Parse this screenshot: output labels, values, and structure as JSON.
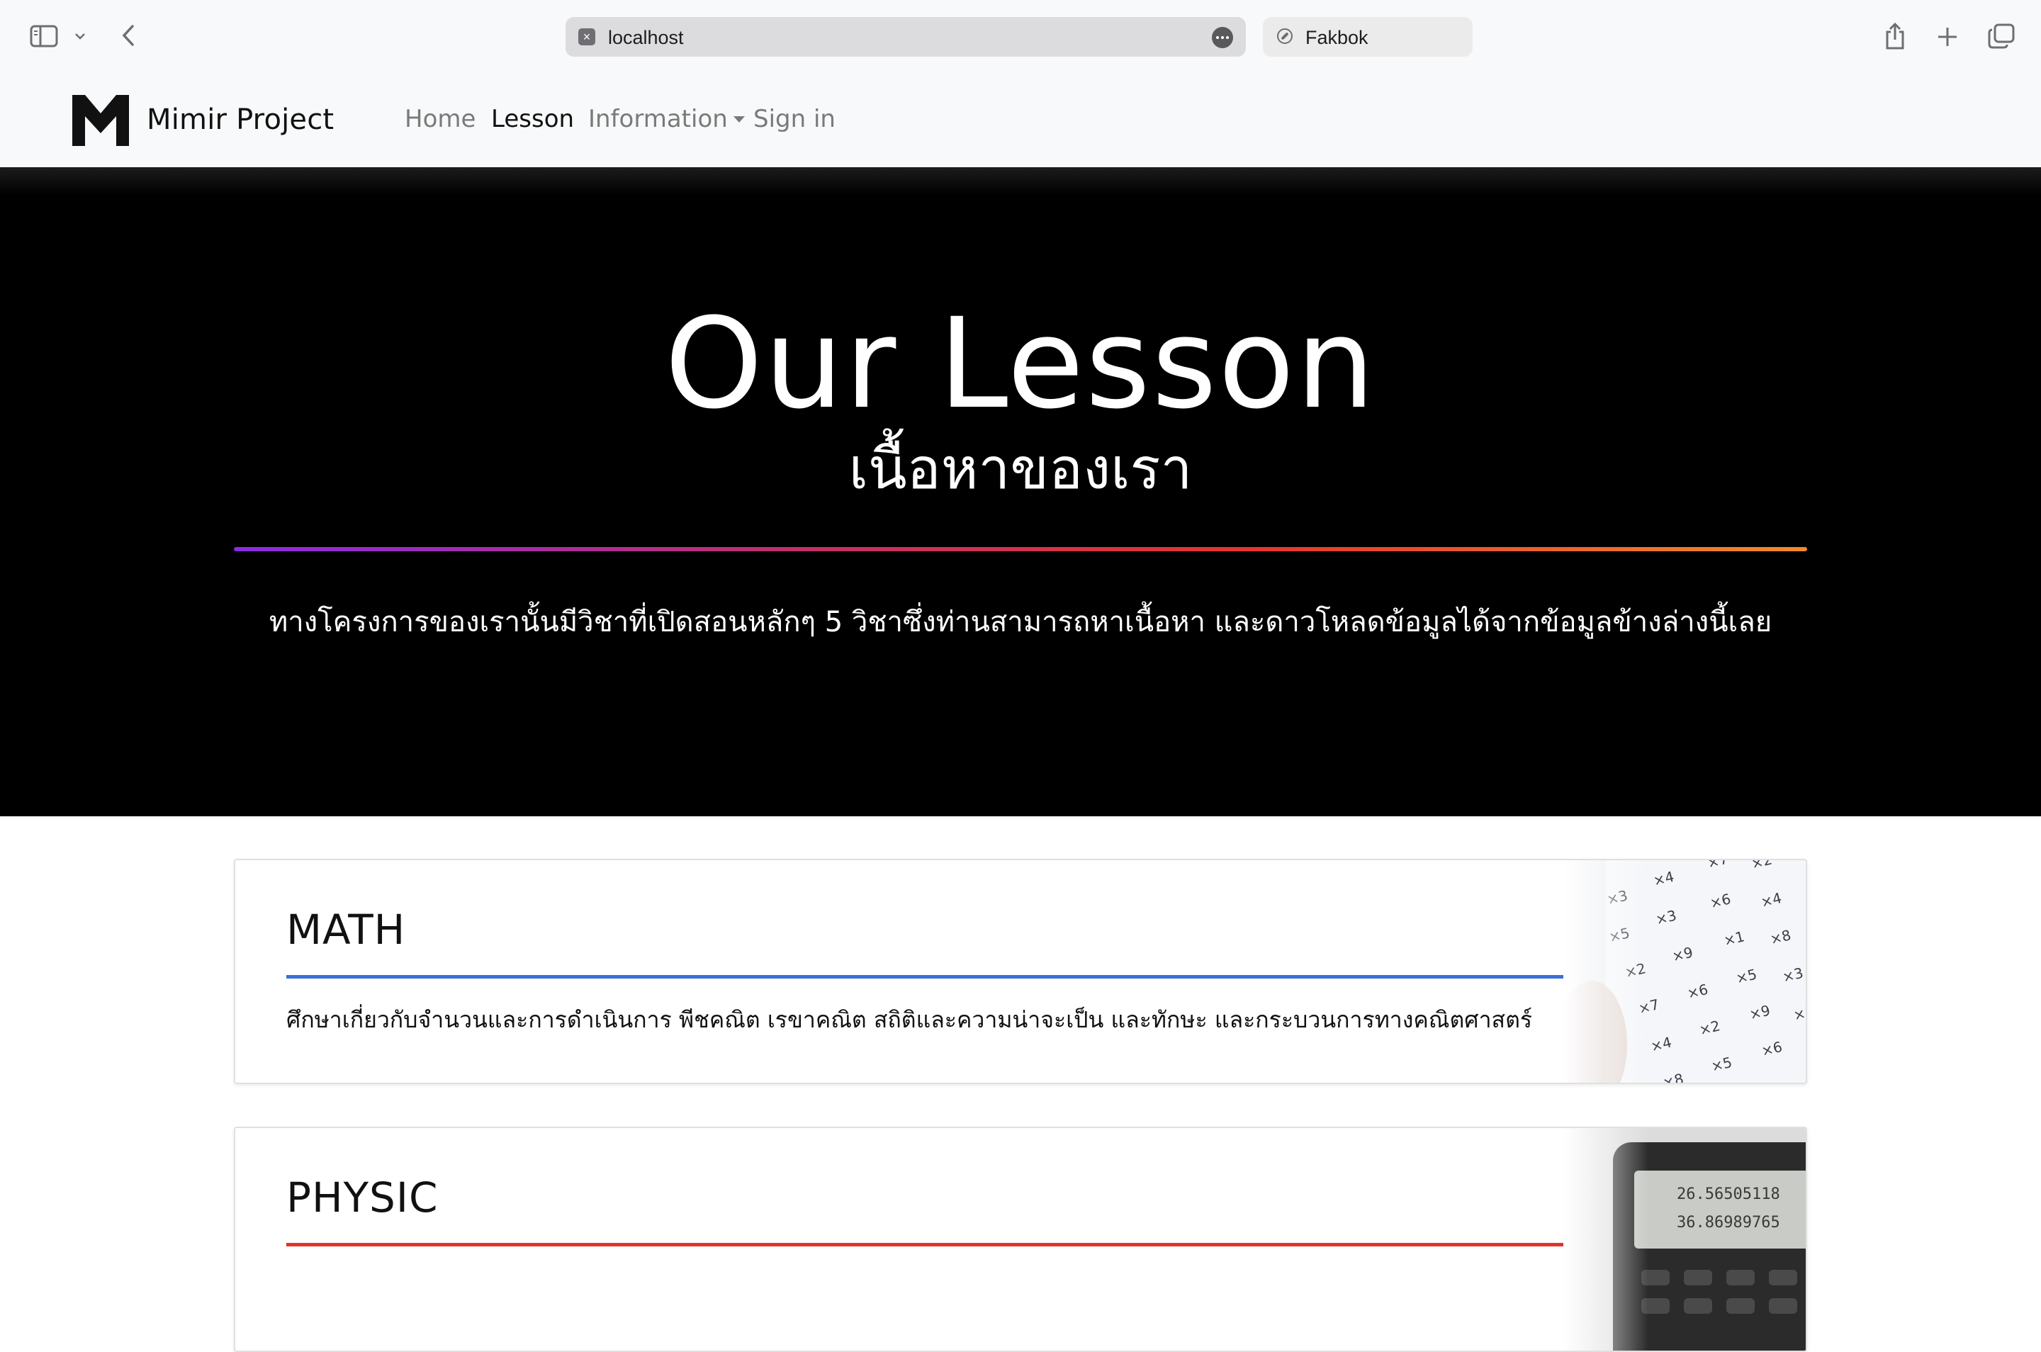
{
  "browser": {
    "url": "localhost",
    "tab_title": "Fakbok",
    "icons": [
      "sidebar-icon",
      "chevron-down-icon",
      "back-icon",
      "site-icon",
      "more-icon",
      "compass-icon",
      "share-icon",
      "new-tab-icon",
      "tabs-overview-icon"
    ]
  },
  "navbar": {
    "brand": "Mimir Project",
    "links": [
      {
        "label": "Home",
        "active": false
      },
      {
        "label": "Lesson",
        "active": true
      },
      {
        "label": "Information",
        "active": false,
        "dropdown": true
      },
      {
        "label": "Sign in",
        "active": false
      }
    ]
  },
  "hero": {
    "title": "Our Lesson",
    "subtitle": "เนื้อหาของเรา",
    "description": "ทางโครงการของเรานั้นมีวิชาที่เปิดสอนหลักๆ 5 วิชาซึ่งท่านสามารถหาเนื้อหา และดาวโหลดข้อมูลได้จากข้อมูลข้างล่างนี้เลย"
  },
  "subjects": [
    {
      "title": "MATH",
      "description": "ศึกษาเกี่ยวกับจำนวนและการดำเนินการ พีชคณิต เรขาคณิต สถิติและความน่าจะเป็น และทักษะ และกระบวนการทางคณิตศาสตร์",
      "accent": "#3b6fd6"
    },
    {
      "title": "PHYSIC",
      "description": "",
      "accent": "#e0352b"
    }
  ],
  "colors": {
    "hero_background": "#000000",
    "navbar_background": "#f8f9fa",
    "divider_gradient": [
      "#8b2be2",
      "#e5352f",
      "#f08a2c"
    ]
  }
}
